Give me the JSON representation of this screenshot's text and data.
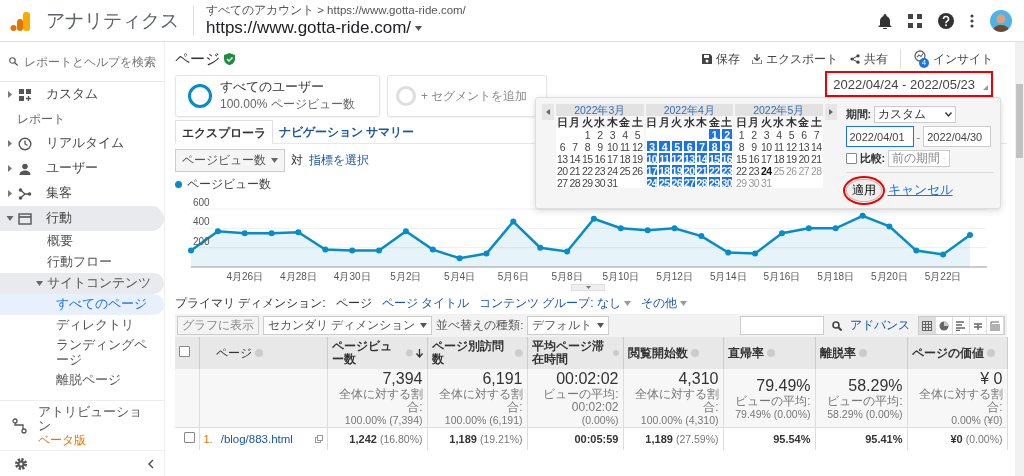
{
  "header": {
    "product": "アナリティクス",
    "breadcrumb": "すべてのアカウント > https://www.gotta-ride.com/",
    "property": "https://www.gotta-ride.com/"
  },
  "sidebar": {
    "search_placeholder": "レポートとヘルプを検索",
    "items": [
      {
        "kind": "nav",
        "label": "カスタム",
        "expanded": false
      },
      {
        "kind": "section",
        "label": "レポート"
      },
      {
        "kind": "nav",
        "label": "リアルタイム",
        "expanded": false
      },
      {
        "kind": "nav",
        "label": "ユーザー",
        "expanded": false
      },
      {
        "kind": "nav",
        "label": "集客",
        "expanded": false
      },
      {
        "kind": "nav",
        "label": "行動",
        "expanded": true,
        "children": [
          {
            "label": "概要",
            "selected": false
          },
          {
            "label": "行動フロー",
            "selected": false
          },
          {
            "label": "サイトコンテンツ",
            "expanded": true,
            "children": [
              {
                "label": "すべてのページ",
                "selected": true
              },
              {
                "label": "ディレクトリ",
                "selected": false
              },
              {
                "label": "ランディングページ",
                "selected": false
              },
              {
                "label": "離脱ページ",
                "selected": false
              }
            ]
          }
        ]
      },
      {
        "kind": "link",
        "label": "アトリビューション",
        "badge": "ベータ版"
      }
    ]
  },
  "page": {
    "title": "ページ",
    "verified": true,
    "actions": [
      {
        "label": "保存"
      },
      {
        "label": "エクスポート"
      },
      {
        "label": "共有"
      },
      {
        "label": "インサイト",
        "badge": "4"
      }
    ]
  },
  "segments": [
    {
      "kind": "segment",
      "label": "すべてのユーザー",
      "sub": "100.00% ページビュー数"
    },
    {
      "kind": "add",
      "label": "+ セグメントを追加"
    }
  ],
  "date_range": {
    "label": "2022/04/24 - 2022/05/23",
    "highlighted": true
  },
  "date_picker": {
    "months": [
      {
        "title": "2022年3月",
        "selected": false,
        "weekdays": [
          "日",
          "月",
          "火",
          "水",
          "木",
          "金",
          "土"
        ],
        "weeks": [
          {
            "partial_start": true,
            "days": [
              "1",
              "2",
              "3",
              "4",
              "5"
            ]
          },
          {
            "days": [
              "6",
              "7",
              "8",
              "9",
              "10",
              "11",
              "12"
            ]
          },
          {
            "days": [
              "13",
              "14",
              "15",
              "16",
              "17",
              "18",
              "19"
            ]
          },
          {
            "days": [
              "20",
              "21",
              "22",
              "23",
              "24",
              "25",
              "26"
            ]
          },
          {
            "days": [
              "27",
              "28",
              "29",
              "30",
              "31"
            ]
          }
        ]
      },
      {
        "title": "2022年4月",
        "selected": true,
        "weekdays": [
          "日",
          "月",
          "火",
          "水",
          "木",
          "金",
          "土"
        ],
        "weeks": [
          {
            "partial_start": true,
            "days": [
              "1",
              "2"
            ]
          },
          {
            "days": [
              "3",
              "4",
              "5",
              "6",
              "7",
              "8",
              "9"
            ]
          },
          {
            "days": [
              "10",
              "11",
              "12",
              "13",
              "14",
              "15",
              "16"
            ]
          },
          {
            "days": [
              "17",
              "18",
              "19",
              "20",
              "21",
              "22",
              "23"
            ]
          },
          {
            "days": [
              "24",
              "25",
              "26",
              "27",
              "28",
              "29",
              "30"
            ]
          }
        ]
      },
      {
        "title": "2022年5月",
        "selected": false,
        "weekdays": [
          "日",
          "月",
          "火",
          "水",
          "木",
          "金",
          "土"
        ],
        "weeks": [
          {
            "days": [
              "1",
              "2",
              "3",
              "4",
              "5",
              "6",
              "7"
            ]
          },
          {
            "days": [
              "8",
              "9",
              "10",
              "11",
              "12",
              "13",
              "14"
            ]
          },
          {
            "days": [
              "15",
              "16",
              "17",
              "18",
              "19",
              "20",
              "21"
            ]
          },
          {
            "days": [
              "22",
              "23",
              {
                "day": "24",
                "today": true
              },
              {
                "day": "25",
                "disabled": true
              },
              {
                "day": "26",
                "disabled": true
              },
              {
                "day": "27",
                "disabled": true
              },
              {
                "day": "28",
                "disabled": true
              }
            ]
          },
          {
            "days": [
              {
                "day": "29",
                "disabled": true
              },
              {
                "day": "30",
                "disabled": true
              },
              {
                "day": "31",
                "disabled": true
              }
            ]
          }
        ]
      }
    ],
    "period_label": "期間:",
    "period": "カスタム",
    "start": "2022/04/01",
    "separator": "-",
    "end": "2022/04/30",
    "compare": {
      "label": "比較:",
      "checked": false,
      "option": "前の期間",
      "disabled": true
    },
    "apply": {
      "label": "適用",
      "highlighted": true
    },
    "cancel": "キャンセル"
  },
  "explorer_tabs": [
    {
      "label": "エクスプローラ",
      "selected": true
    },
    {
      "label": "ナビゲーション サマリー",
      "selected": false
    }
  ],
  "metric": {
    "value": "ページビュー数",
    "versus": "対",
    "select_link": "指標を選択"
  },
  "chart": {
    "chart_data": {
      "type": "area",
      "categories": [
        null,
        null,
        "4月26日",
        null,
        "4月28日",
        null,
        "4月30日",
        null,
        "5月2日",
        null,
        "5月4日",
        null,
        "5月6日",
        null,
        "5月8日",
        null,
        "5月10日",
        null,
        "5月12日",
        null,
        "5月14日",
        null,
        "5月16日",
        null,
        "5月18日",
        null,
        "5月20日",
        null,
        "5月22日",
        null
      ],
      "series": [
        {
          "name": "ページビュー数",
          "color": "#058dc7",
          "values": [
            170,
            370,
            350,
            350,
            360,
            180,
            170,
            170,
            370,
            180,
            90,
            140,
            470,
            200,
            160,
            500,
            400,
            380,
            400,
            320,
            150,
            140,
            350,
            400,
            400,
            530,
            420,
            170,
            130,
            330
          ]
        }
      ],
      "ylim": [
        0,
        600
      ],
      "yticks": [
        200,
        400,
        600
      ]
    }
  },
  "dimensions": {
    "label": "プライマリ ディメンション:",
    "options": [
      {
        "label": "ページ",
        "selected": true,
        "dropdown": false
      },
      {
        "label": "ページ タイトル",
        "selected": false,
        "dropdown": false
      },
      {
        "label": "コンテンツ グループ: なし",
        "selected": false,
        "dropdown": true
      },
      {
        "label": "その他",
        "selected": false,
        "dropdown": true
      }
    ]
  },
  "table_toolbar": {
    "plot_button": {
      "label": "グラフに表示",
      "disabled": true
    },
    "secondary": "セカンダリ ディメンション",
    "sort_label": "並べ替えの種類:",
    "sort": "デフォルト",
    "advanced": "アドバンス",
    "views": [
      {
        "selected": true
      },
      {
        "selected": false
      },
      {
        "selected": false
      },
      {
        "selected": false
      },
      {
        "selected": false
      }
    ]
  },
  "table": {
    "select_all": {
      "checked": false
    },
    "columns": [
      {
        "label": "ページ",
        "sorted": false
      },
      {
        "label": "ページビュー数",
        "sorted": true
      },
      {
        "label": "ページ別訪問数",
        "sorted": false
      },
      {
        "label": "平均ページ滞在時間",
        "sorted": false
      },
      {
        "label": "閲覧開始数",
        "sorted": false
      },
      {
        "label": "直帰率",
        "sorted": false
      },
      {
        "label": "離脱率",
        "sorted": false
      },
      {
        "label": "ページの価値",
        "sorted": false
      }
    ],
    "totals": [
      {
        "value": "7,394",
        "note": "全体に対する割合:",
        "detail": "100.00% (7,394)"
      },
      {
        "value": "6,191",
        "note": "全体に対する割合:",
        "detail": "100.00% (6,191)"
      },
      {
        "value": "00:02:02",
        "note": "ビューの平均: 00:02:02",
        "detail": "(0.00%)"
      },
      {
        "value": "4,310",
        "note": "全体に対する割合:",
        "detail": "100.00% (4,310)"
      },
      {
        "value": "79.49%",
        "note": "ビューの平均:",
        "detail": "79.49% (0.00%)"
      },
      {
        "value": "58.29%",
        "note": "ビューの平均:",
        "detail": "58.29% (0.00%)"
      },
      {
        "value": "¥ 0",
        "note": "全体に対する割合:",
        "detail": "0.00% (¥0)"
      }
    ],
    "rows": [
      {
        "checked": false,
        "cells": [
          {
            "index": "1.",
            "link": "/blog/883.html"
          },
          {
            "value": "1,242",
            "share": "(16.80%)"
          },
          {
            "value": "1,189",
            "share": "(19.21%)"
          },
          {
            "value": "00:05:59"
          },
          {
            "value": "1,189",
            "share": "(27.59%)"
          },
          {
            "value": "95.54%"
          },
          {
            "value": "95.41%"
          },
          {
            "value": "¥0",
            "share": "(0.00%)"
          }
        ]
      }
    ]
  }
}
